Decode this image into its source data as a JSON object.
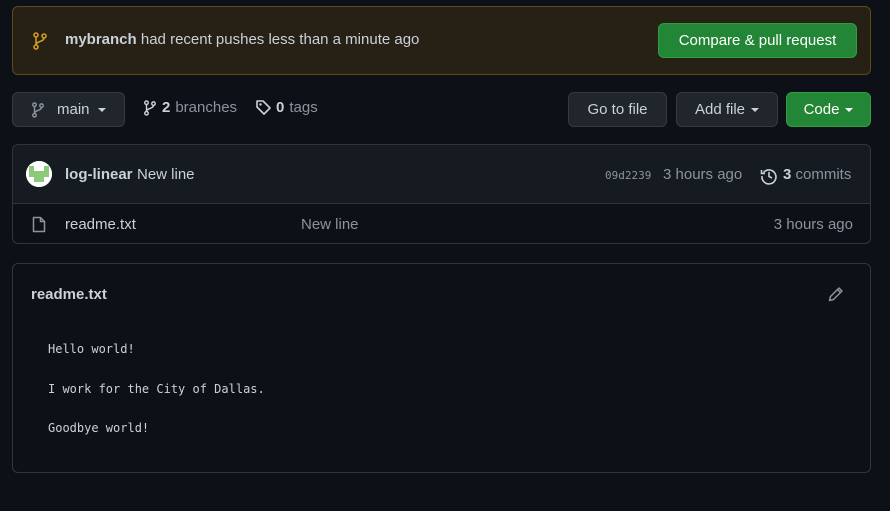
{
  "banner": {
    "branch": "mybranch",
    "message": "had recent pushes less than a minute ago",
    "compare_button": "Compare & pull request"
  },
  "toolbar": {
    "branch_select": "main",
    "branches_count": "2",
    "branches_label": "branches",
    "tags_count": "0",
    "tags_label": "tags",
    "go_to_file": "Go to file",
    "add_file": "Add file",
    "code": "Code"
  },
  "latest_commit": {
    "author": "log-linear",
    "message": "New line",
    "sha": "09d2239",
    "time": "3 hours ago",
    "commits_count": "3",
    "commits_label": "commits"
  },
  "files": [
    {
      "name": "readme.txt",
      "message": "New line",
      "time": "3 hours ago",
      "icon": "file-icon"
    }
  ],
  "readme": {
    "title": "readme.txt",
    "lines": [
      "Hello world!",
      "I work for the City of Dallas.",
      "Goodbye world!"
    ]
  },
  "colors": {
    "background": "#0d1117",
    "banner_bg": "#272115",
    "banner_border": "#5f4a15",
    "branch_icon": "#d29922",
    "green_button": "#238636",
    "dark_button": "#21262d"
  }
}
